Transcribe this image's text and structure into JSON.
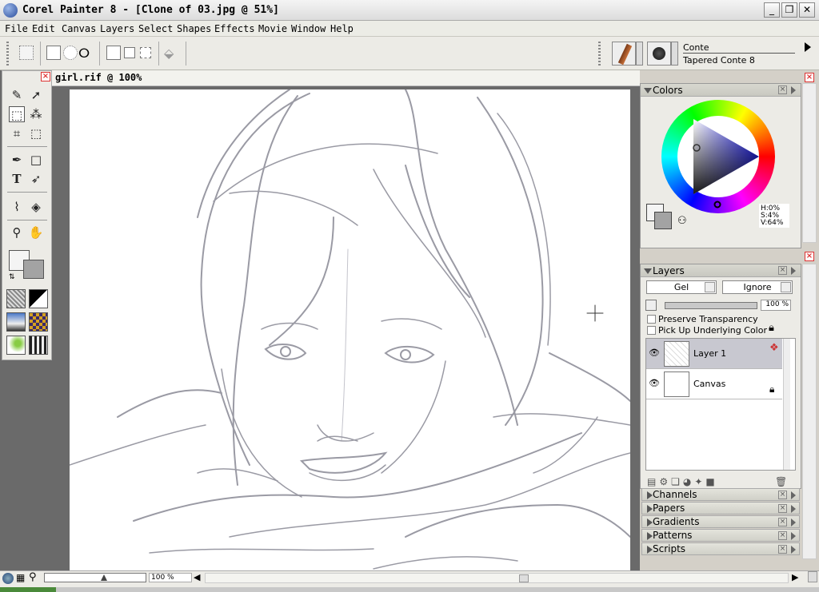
{
  "window": {
    "title": "Corel Painter 8 - [Clone of 03.jpg @ 51%]",
    "minimize": "_",
    "restore": "❐",
    "close": "✕"
  },
  "menu": [
    "File",
    "Edit",
    "Canvas",
    "Layers",
    "Select",
    "Shapes",
    "Effects",
    "Movie",
    "Window",
    "Help"
  ],
  "brush": {
    "category": "Conte",
    "variant": "Tapered Conte 8"
  },
  "document": {
    "tab_title": "girl.rif @ 100%"
  },
  "colors_panel": {
    "title": "Colors",
    "hsv": {
      "h": "H:0%",
      "s": "S:4%",
      "v": "V:64%"
    },
    "primary_color": "#f4f4f4",
    "secondary_color": "#a3a3a3"
  },
  "layers_panel": {
    "title": "Layers",
    "composite_method": "Gel",
    "composite_depth": "Ignore",
    "opacity": "100 %",
    "opacity_fraction": 1.0,
    "preserve_transparency": "Preserve Transparency",
    "pick_up_color": "Pick Up Underlying Color",
    "layers": [
      {
        "name": "Layer 1",
        "selected": true
      },
      {
        "name": "Canvas",
        "selected": false
      }
    ]
  },
  "collapsed_panels": [
    "Channels",
    "Papers",
    "Gradients",
    "Patterns",
    "Scripts"
  ],
  "status": {
    "zoom": "100 %"
  },
  "accent": {
    "selected_row": "#c8c8d0",
    "close_red": "#dd3333"
  }
}
